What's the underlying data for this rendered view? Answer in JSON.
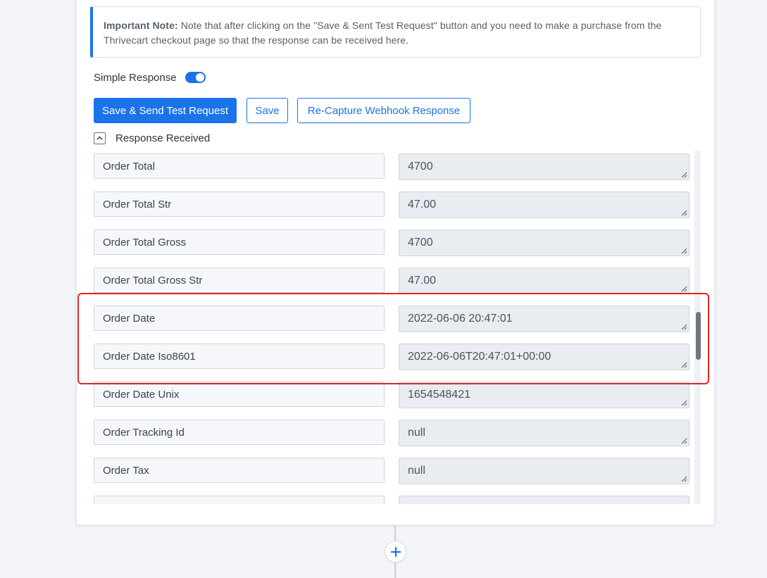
{
  "note": {
    "label": "Important Note:",
    "text": " Note that after clicking on the \"Save & Sent Test Request\" button and you need to make a purchase from the Thrivecart checkout page so that the response can be received here."
  },
  "simple_response": {
    "label": "Simple Response",
    "enabled": true
  },
  "buttons": {
    "save_send": "Save & Send Test Request",
    "save": "Save",
    "recapture": "Re-Capture Webhook Response"
  },
  "response": {
    "label": "Response Received",
    "fields": [
      {
        "key": "Order Total",
        "value": "4700"
      },
      {
        "key": "Order Total Str",
        "value": "47.00"
      },
      {
        "key": "Order Total Gross",
        "value": "4700"
      },
      {
        "key": "Order Total Gross Str",
        "value": "47.00"
      },
      {
        "key": "Order Date",
        "value": "2022-06-06 20:47:01"
      },
      {
        "key": "Order Date Iso8601",
        "value": "2022-06-06T20:47:01+00:00"
      },
      {
        "key": "Order Date Unix",
        "value": "1654548421"
      },
      {
        "key": "Order Tracking Id",
        "value": "null"
      },
      {
        "key": "Order Tax",
        "value": "null"
      },
      {
        "key": "",
        "value": ""
      }
    ]
  },
  "colors": {
    "accent": "#1a73e8",
    "highlight": "#e02424"
  },
  "icons": {
    "collapse": "chevron-up-icon",
    "add": "plus-icon",
    "resize": "resize-grip-icon"
  }
}
